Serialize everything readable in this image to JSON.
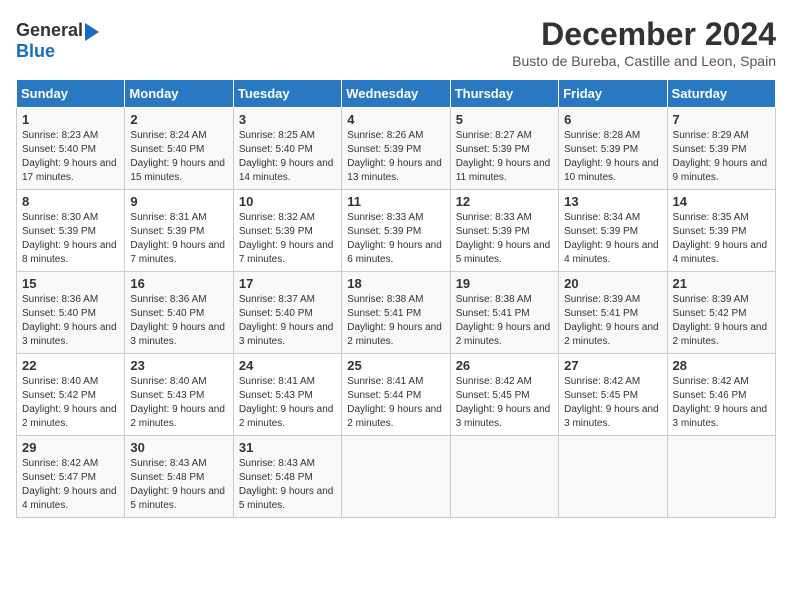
{
  "header": {
    "logo_general": "General",
    "logo_blue": "Blue",
    "month": "December 2024",
    "location": "Busto de Bureba, Castille and Leon, Spain"
  },
  "days_of_week": [
    "Sunday",
    "Monday",
    "Tuesday",
    "Wednesday",
    "Thursday",
    "Friday",
    "Saturday"
  ],
  "weeks": [
    [
      {
        "day": "1",
        "text": "Sunrise: 8:23 AM\nSunset: 5:40 PM\nDaylight: 9 hours and 17 minutes."
      },
      {
        "day": "2",
        "text": "Sunrise: 8:24 AM\nSunset: 5:40 PM\nDaylight: 9 hours and 15 minutes."
      },
      {
        "day": "3",
        "text": "Sunrise: 8:25 AM\nSunset: 5:40 PM\nDaylight: 9 hours and 14 minutes."
      },
      {
        "day": "4",
        "text": "Sunrise: 8:26 AM\nSunset: 5:39 PM\nDaylight: 9 hours and 13 minutes."
      },
      {
        "day": "5",
        "text": "Sunrise: 8:27 AM\nSunset: 5:39 PM\nDaylight: 9 hours and 11 minutes."
      },
      {
        "day": "6",
        "text": "Sunrise: 8:28 AM\nSunset: 5:39 PM\nDaylight: 9 hours and 10 minutes."
      },
      {
        "day": "7",
        "text": "Sunrise: 8:29 AM\nSunset: 5:39 PM\nDaylight: 9 hours and 9 minutes."
      }
    ],
    [
      {
        "day": "8",
        "text": "Sunrise: 8:30 AM\nSunset: 5:39 PM\nDaylight: 9 hours and 8 minutes."
      },
      {
        "day": "9",
        "text": "Sunrise: 8:31 AM\nSunset: 5:39 PM\nDaylight: 9 hours and 7 minutes."
      },
      {
        "day": "10",
        "text": "Sunrise: 8:32 AM\nSunset: 5:39 PM\nDaylight: 9 hours and 7 minutes."
      },
      {
        "day": "11",
        "text": "Sunrise: 8:33 AM\nSunset: 5:39 PM\nDaylight: 9 hours and 6 minutes."
      },
      {
        "day": "12",
        "text": "Sunrise: 8:33 AM\nSunset: 5:39 PM\nDaylight: 9 hours and 5 minutes."
      },
      {
        "day": "13",
        "text": "Sunrise: 8:34 AM\nSunset: 5:39 PM\nDaylight: 9 hours and 4 minutes."
      },
      {
        "day": "14",
        "text": "Sunrise: 8:35 AM\nSunset: 5:39 PM\nDaylight: 9 hours and 4 minutes."
      }
    ],
    [
      {
        "day": "15",
        "text": "Sunrise: 8:36 AM\nSunset: 5:40 PM\nDaylight: 9 hours and 3 minutes."
      },
      {
        "day": "16",
        "text": "Sunrise: 8:36 AM\nSunset: 5:40 PM\nDaylight: 9 hours and 3 minutes."
      },
      {
        "day": "17",
        "text": "Sunrise: 8:37 AM\nSunset: 5:40 PM\nDaylight: 9 hours and 3 minutes."
      },
      {
        "day": "18",
        "text": "Sunrise: 8:38 AM\nSunset: 5:41 PM\nDaylight: 9 hours and 2 minutes."
      },
      {
        "day": "19",
        "text": "Sunrise: 8:38 AM\nSunset: 5:41 PM\nDaylight: 9 hours and 2 minutes."
      },
      {
        "day": "20",
        "text": "Sunrise: 8:39 AM\nSunset: 5:41 PM\nDaylight: 9 hours and 2 minutes."
      },
      {
        "day": "21",
        "text": "Sunrise: 8:39 AM\nSunset: 5:42 PM\nDaylight: 9 hours and 2 minutes."
      }
    ],
    [
      {
        "day": "22",
        "text": "Sunrise: 8:40 AM\nSunset: 5:42 PM\nDaylight: 9 hours and 2 minutes."
      },
      {
        "day": "23",
        "text": "Sunrise: 8:40 AM\nSunset: 5:43 PM\nDaylight: 9 hours and 2 minutes."
      },
      {
        "day": "24",
        "text": "Sunrise: 8:41 AM\nSunset: 5:43 PM\nDaylight: 9 hours and 2 minutes."
      },
      {
        "day": "25",
        "text": "Sunrise: 8:41 AM\nSunset: 5:44 PM\nDaylight: 9 hours and 2 minutes."
      },
      {
        "day": "26",
        "text": "Sunrise: 8:42 AM\nSunset: 5:45 PM\nDaylight: 9 hours and 3 minutes."
      },
      {
        "day": "27",
        "text": "Sunrise: 8:42 AM\nSunset: 5:45 PM\nDaylight: 9 hours and 3 minutes."
      },
      {
        "day": "28",
        "text": "Sunrise: 8:42 AM\nSunset: 5:46 PM\nDaylight: 9 hours and 3 minutes."
      }
    ],
    [
      {
        "day": "29",
        "text": "Sunrise: 8:42 AM\nSunset: 5:47 PM\nDaylight: 9 hours and 4 minutes."
      },
      {
        "day": "30",
        "text": "Sunrise: 8:43 AM\nSunset: 5:48 PM\nDaylight: 9 hours and 5 minutes."
      },
      {
        "day": "31",
        "text": "Sunrise: 8:43 AM\nSunset: 5:48 PM\nDaylight: 9 hours and 5 minutes."
      },
      null,
      null,
      null,
      null
    ]
  ]
}
